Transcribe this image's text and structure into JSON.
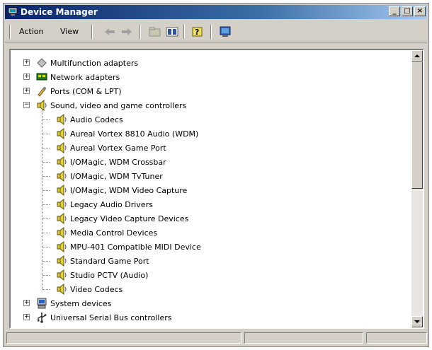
{
  "window": {
    "title": "Device Manager"
  },
  "caption_buttons": {
    "minimize": "_",
    "maximize": "□",
    "close": "×"
  },
  "menu": {
    "action": "Action",
    "view": "View"
  },
  "tree": {
    "top_categories": [
      {
        "label": "Multifunction adapters",
        "expander": "+"
      },
      {
        "label": "Network adapters",
        "expander": "+"
      },
      {
        "label": "Ports (COM & LPT)",
        "expander": "+"
      },
      {
        "label": "Sound, video and game controllers",
        "expander": "−"
      }
    ],
    "sound_children": [
      "Audio Codecs",
      "Aureal Vortex 8810 Audio (WDM)",
      "Aureal Vortex Game Port",
      "I/OMagic, WDM Crossbar",
      "I/OMagic, WDM TvTuner",
      "I/OMagic, WDM Video Capture",
      "Legacy Audio Drivers",
      "Legacy Video Capture Devices",
      "Media Control Devices",
      "MPU-401 Compatible MIDI Device",
      "Standard Game Port",
      "Studio PCTV (Audio)",
      "Video Codecs"
    ],
    "bottom_categories": [
      {
        "label": "System devices",
        "expander": "+"
      },
      {
        "label": "Universal Serial Bus controllers",
        "expander": "+"
      }
    ]
  },
  "scroll": {
    "thumb_fraction_start": 0.0,
    "thumb_fraction_size": 0.5
  }
}
